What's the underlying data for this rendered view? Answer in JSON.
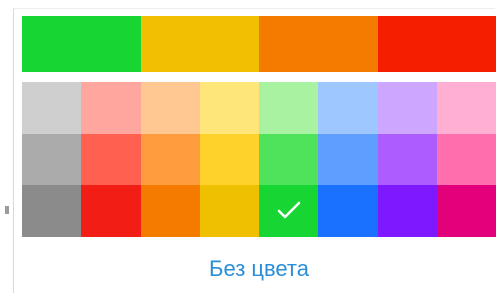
{
  "palette": {
    "top": [
      {
        "name": "green",
        "color": "#17d532"
      },
      {
        "name": "yellow",
        "color": "#f1c000"
      },
      {
        "name": "orange",
        "color": "#f57a00"
      },
      {
        "name": "red",
        "color": "#f51f00"
      }
    ],
    "rows": [
      [
        "#cfcfcf",
        "#ffa69e",
        "#ffc892",
        "#ffe67b",
        "#a8f2a2",
        "#9fc7ff",
        "#cda6ff",
        "#ffb0d2"
      ],
      [
        "#ababab",
        "#ff6050",
        "#ff9c3d",
        "#ffd22b",
        "#4fe25b",
        "#5f9eff",
        "#ad5dff",
        "#ff6fae"
      ],
      [
        "#8b8b8b",
        "#f21d14",
        "#f47a00",
        "#efc000",
        "#17d532",
        "#1a70ff",
        "#7e18ff",
        "#e2007b"
      ]
    ],
    "selected": {
      "row": 2,
      "col": 4
    },
    "check_icon": "check-icon"
  },
  "action": {
    "label": "Без цвета",
    "color": "#2a8ed8"
  }
}
